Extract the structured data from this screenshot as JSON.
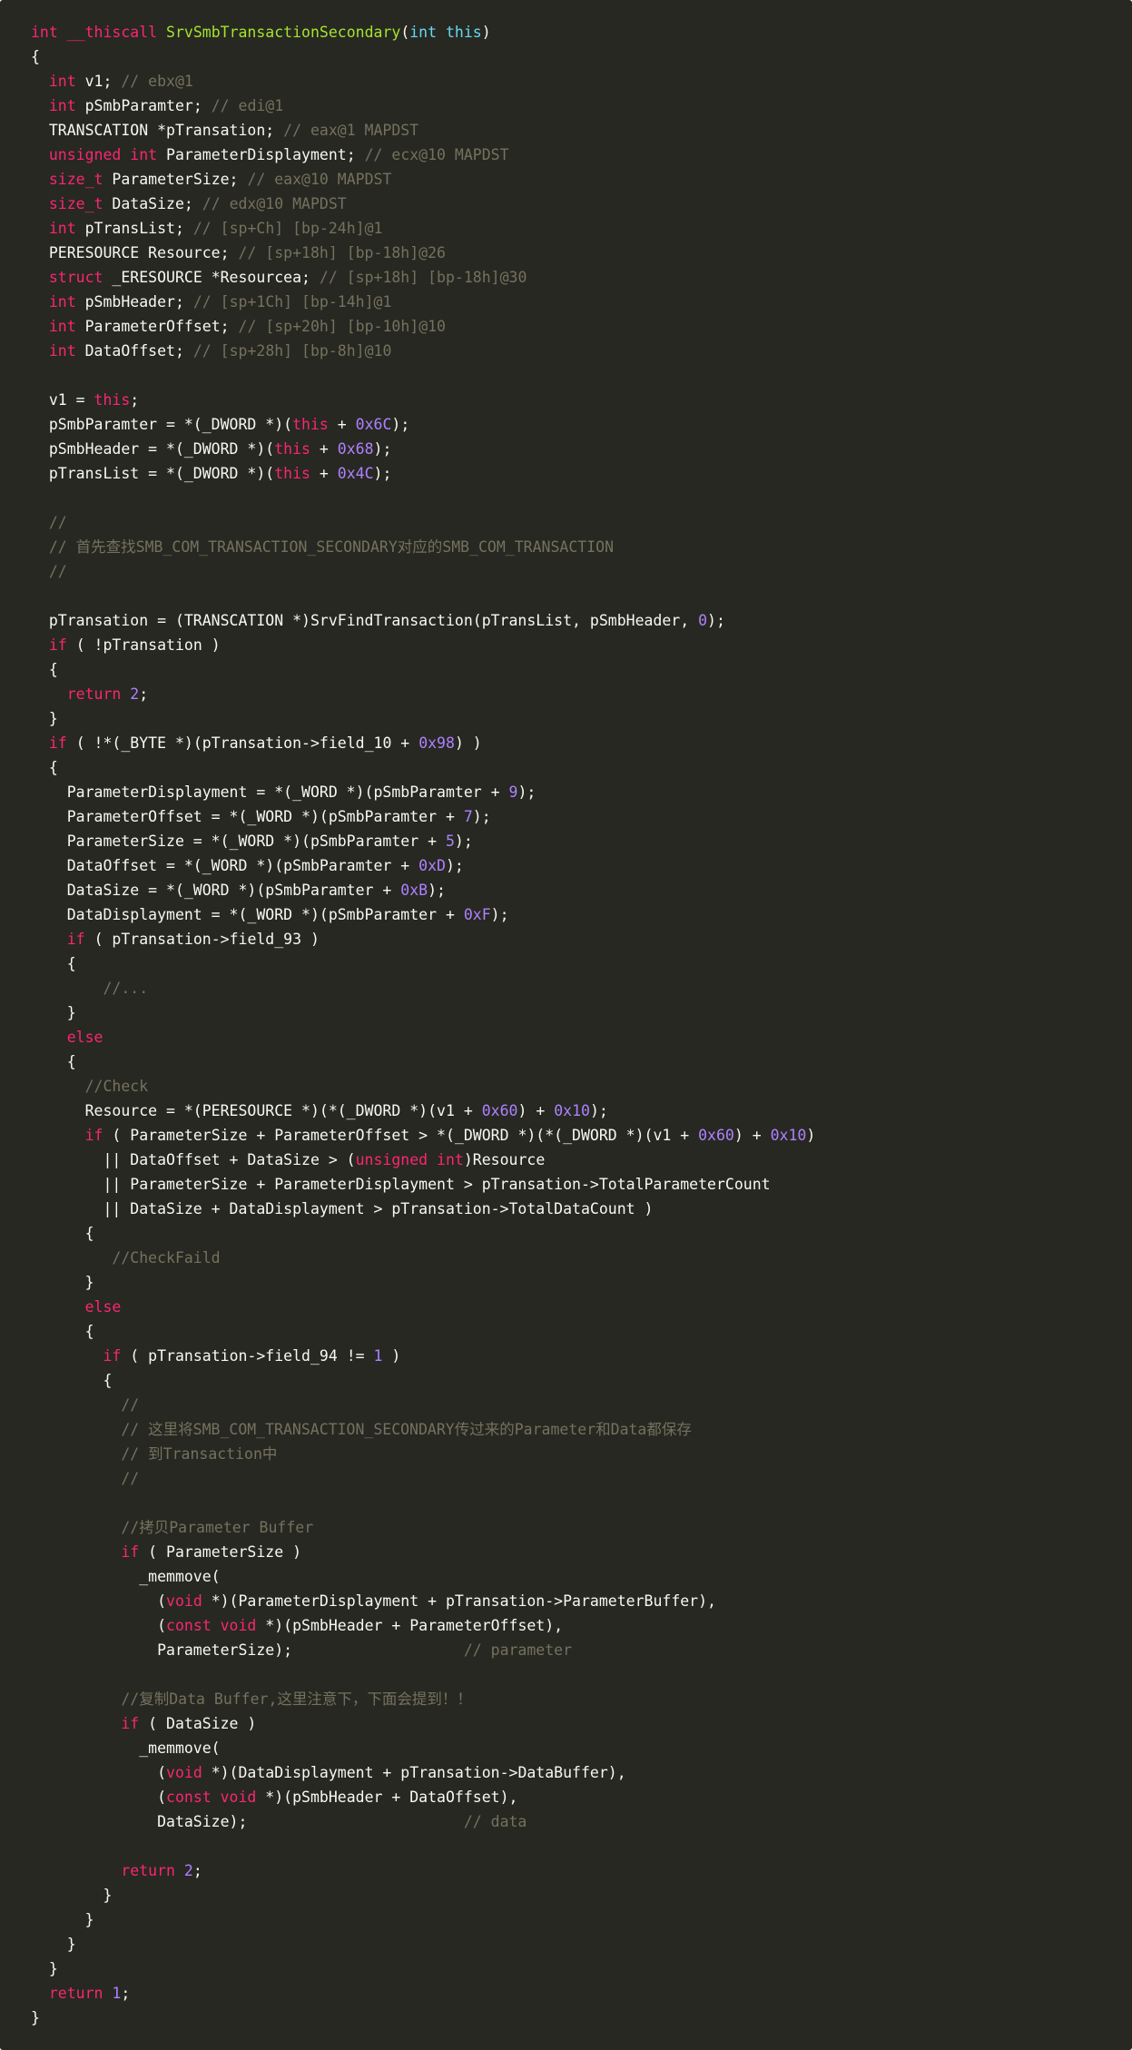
{
  "colors": {
    "background": "#272822",
    "plain": "#f8f8f2",
    "keyword": "#f92672",
    "type": "#66d9ef",
    "function": "#a6e22e",
    "number": "#ae81ff",
    "comment": "#75715e"
  },
  "code": {
    "lines": [
      [
        [
          "kw",
          "int "
        ],
        [
          "kw",
          "__thiscall "
        ],
        [
          "fn",
          "SrvSmbTransactionSecondary"
        ],
        [
          "pl",
          "("
        ],
        [
          "ty",
          "int "
        ],
        [
          "ty",
          "this"
        ],
        [
          "pl",
          ")"
        ]
      ],
      [
        [
          "pl",
          "{"
        ]
      ],
      [
        [
          "pl",
          "  "
        ],
        [
          "kw",
          "int "
        ],
        [
          "pl",
          "v1; "
        ],
        [
          "cm",
          "// ebx@1"
        ]
      ],
      [
        [
          "pl",
          "  "
        ],
        [
          "kw",
          "int "
        ],
        [
          "pl",
          "pSmbParamter; "
        ],
        [
          "cm",
          "// edi@1"
        ]
      ],
      [
        [
          "pl",
          "  TRANSCATION *pTransation; "
        ],
        [
          "cm",
          "// eax@1 MAPDST"
        ]
      ],
      [
        [
          "pl",
          "  "
        ],
        [
          "kw",
          "unsigned "
        ],
        [
          "kw",
          "int "
        ],
        [
          "pl",
          "ParameterDisplayment; "
        ],
        [
          "cm",
          "// ecx@10 MAPDST"
        ]
      ],
      [
        [
          "pl",
          "  "
        ],
        [
          "kw",
          "size_t "
        ],
        [
          "pl",
          "ParameterSize; "
        ],
        [
          "cm",
          "// eax@10 MAPDST"
        ]
      ],
      [
        [
          "pl",
          "  "
        ],
        [
          "kw",
          "size_t "
        ],
        [
          "pl",
          "DataSize; "
        ],
        [
          "cm",
          "// edx@10 MAPDST"
        ]
      ],
      [
        [
          "pl",
          "  "
        ],
        [
          "kw",
          "int "
        ],
        [
          "pl",
          "pTransList; "
        ],
        [
          "cm",
          "// [sp+Ch] [bp-24h]@1"
        ]
      ],
      [
        [
          "pl",
          "  PERESOURCE Resource; "
        ],
        [
          "cm",
          "// [sp+18h] [bp-18h]@26"
        ]
      ],
      [
        [
          "pl",
          "  "
        ],
        [
          "kw",
          "struct "
        ],
        [
          "pl",
          "_ERESOURCE *Resourcea; "
        ],
        [
          "cm",
          "// [sp+18h] [bp-18h]@30"
        ]
      ],
      [
        [
          "pl",
          "  "
        ],
        [
          "kw",
          "int "
        ],
        [
          "pl",
          "pSmbHeader; "
        ],
        [
          "cm",
          "// [sp+1Ch] [bp-14h]@1"
        ]
      ],
      [
        [
          "pl",
          "  "
        ],
        [
          "kw",
          "int "
        ],
        [
          "pl",
          "ParameterOffset; "
        ],
        [
          "cm",
          "// [sp+20h] [bp-10h]@10"
        ]
      ],
      [
        [
          "pl",
          "  "
        ],
        [
          "kw",
          "int "
        ],
        [
          "pl",
          "DataOffset; "
        ],
        [
          "cm",
          "// [sp+28h] [bp-8h]@10"
        ]
      ],
      [],
      [
        [
          "pl",
          "  v1 = "
        ],
        [
          "kw",
          "this"
        ],
        [
          "pl",
          ";"
        ]
      ],
      [
        [
          "pl",
          "  pSmbParamter = *(_DWORD *)("
        ],
        [
          "kw",
          "this"
        ],
        [
          "pl",
          " + "
        ],
        [
          "nm",
          "0x6C"
        ],
        [
          "pl",
          ");"
        ]
      ],
      [
        [
          "pl",
          "  pSmbHeader = *(_DWORD *)("
        ],
        [
          "kw",
          "this"
        ],
        [
          "pl",
          " + "
        ],
        [
          "nm",
          "0x68"
        ],
        [
          "pl",
          ");"
        ]
      ],
      [
        [
          "pl",
          "  pTransList = *(_DWORD *)("
        ],
        [
          "kw",
          "this"
        ],
        [
          "pl",
          " + "
        ],
        [
          "nm",
          "0x4C"
        ],
        [
          "pl",
          ");"
        ]
      ],
      [],
      [
        [
          "pl",
          "  "
        ],
        [
          "cm",
          "//"
        ]
      ],
      [
        [
          "pl",
          "  "
        ],
        [
          "cm",
          "// 首先查找SMB_COM_TRANSACTION_SECONDARY对应的SMB_COM_TRANSACTION"
        ]
      ],
      [
        [
          "pl",
          "  "
        ],
        [
          "cm",
          "//"
        ]
      ],
      [],
      [
        [
          "pl",
          "  pTransation = (TRANSCATION *)SrvFindTransaction(pTransList, pSmbHeader, "
        ],
        [
          "nm",
          "0"
        ],
        [
          "pl",
          ");"
        ]
      ],
      [
        [
          "pl",
          "  "
        ],
        [
          "kw",
          "if "
        ],
        [
          "pl",
          "( !pTransation )"
        ]
      ],
      [
        [
          "pl",
          "  {"
        ]
      ],
      [
        [
          "pl",
          "    "
        ],
        [
          "kw",
          "return "
        ],
        [
          "nm",
          "2"
        ],
        [
          "pl",
          ";"
        ]
      ],
      [
        [
          "pl",
          "  }"
        ]
      ],
      [
        [
          "pl",
          "  "
        ],
        [
          "kw",
          "if "
        ],
        [
          "pl",
          "( !*(_BYTE *)(pTransation->field_10 + "
        ],
        [
          "nm",
          "0x98"
        ],
        [
          "pl",
          ") )"
        ]
      ],
      [
        [
          "pl",
          "  {"
        ]
      ],
      [
        [
          "pl",
          "    ParameterDisplayment = *(_WORD *)(pSmbParamter + "
        ],
        [
          "nm",
          "9"
        ],
        [
          "pl",
          ");"
        ]
      ],
      [
        [
          "pl",
          "    ParameterOffset = *(_WORD *)(pSmbParamter + "
        ],
        [
          "nm",
          "7"
        ],
        [
          "pl",
          ");"
        ]
      ],
      [
        [
          "pl",
          "    ParameterSize = *(_WORD *)(pSmbParamter + "
        ],
        [
          "nm",
          "5"
        ],
        [
          "pl",
          ");"
        ]
      ],
      [
        [
          "pl",
          "    DataOffset = *(_WORD *)(pSmbParamter + "
        ],
        [
          "nm",
          "0xD"
        ],
        [
          "pl",
          ");"
        ]
      ],
      [
        [
          "pl",
          "    DataSize = *(_WORD *)(pSmbParamter + "
        ],
        [
          "nm",
          "0xB"
        ],
        [
          "pl",
          ");"
        ]
      ],
      [
        [
          "pl",
          "    DataDisplayment = *(_WORD *)(pSmbParamter + "
        ],
        [
          "nm",
          "0xF"
        ],
        [
          "pl",
          ");"
        ]
      ],
      [
        [
          "pl",
          "    "
        ],
        [
          "kw",
          "if "
        ],
        [
          "pl",
          "( pTransation->field_93 )"
        ]
      ],
      [
        [
          "pl",
          "    {"
        ]
      ],
      [
        [
          "pl",
          "        "
        ],
        [
          "cm",
          "//..."
        ]
      ],
      [
        [
          "pl",
          "    }"
        ]
      ],
      [
        [
          "pl",
          "    "
        ],
        [
          "kw",
          "else"
        ]
      ],
      [
        [
          "pl",
          "    {"
        ]
      ],
      [
        [
          "pl",
          "      "
        ],
        [
          "cm",
          "//Check"
        ]
      ],
      [
        [
          "pl",
          "      Resource = *(PERESOURCE *)(*(_DWORD *)(v1 + "
        ],
        [
          "nm",
          "0x60"
        ],
        [
          "pl",
          ") + "
        ],
        [
          "nm",
          "0x10"
        ],
        [
          "pl",
          ");"
        ]
      ],
      [
        [
          "pl",
          "      "
        ],
        [
          "kw",
          "if "
        ],
        [
          "pl",
          "( ParameterSize + ParameterOffset > *(_DWORD *)(*(_DWORD *)(v1 + "
        ],
        [
          "nm",
          "0x60"
        ],
        [
          "pl",
          ") + "
        ],
        [
          "nm",
          "0x10"
        ],
        [
          "pl",
          ")"
        ]
      ],
      [
        [
          "pl",
          "        || DataOffset + DataSize > ("
        ],
        [
          "kw",
          "unsigned "
        ],
        [
          "kw",
          "int"
        ],
        [
          "pl",
          ")Resource"
        ]
      ],
      [
        [
          "pl",
          "        || ParameterSize + ParameterDisplayment > pTransation->TotalParameterCount"
        ]
      ],
      [
        [
          "pl",
          "        || DataSize + DataDisplayment > pTransation->TotalDataCount )"
        ]
      ],
      [
        [
          "pl",
          "      {"
        ]
      ],
      [
        [
          "pl",
          "         "
        ],
        [
          "cm",
          "//CheckFaild"
        ]
      ],
      [
        [
          "pl",
          "      }"
        ]
      ],
      [
        [
          "pl",
          "      "
        ],
        [
          "kw",
          "else"
        ]
      ],
      [
        [
          "pl",
          "      {"
        ]
      ],
      [
        [
          "pl",
          "        "
        ],
        [
          "kw",
          "if "
        ],
        [
          "pl",
          "( pTransation->field_94 != "
        ],
        [
          "nm",
          "1"
        ],
        [
          "pl",
          " )"
        ]
      ],
      [
        [
          "pl",
          "        {"
        ]
      ],
      [
        [
          "pl",
          "          "
        ],
        [
          "cm",
          "//"
        ]
      ],
      [
        [
          "pl",
          "          "
        ],
        [
          "cm",
          "// 这里将SMB_COM_TRANSACTION_SECONDARY传过来的Parameter和Data都保存"
        ]
      ],
      [
        [
          "pl",
          "          "
        ],
        [
          "cm",
          "// 到Transaction中"
        ]
      ],
      [
        [
          "pl",
          "          "
        ],
        [
          "cm",
          "//"
        ]
      ],
      [],
      [
        [
          "pl",
          "          "
        ],
        [
          "cm",
          "//拷贝Parameter Buffer"
        ]
      ],
      [
        [
          "pl",
          "          "
        ],
        [
          "kw",
          "if "
        ],
        [
          "pl",
          "( ParameterSize )"
        ]
      ],
      [
        [
          "pl",
          "            _memmove("
        ]
      ],
      [
        [
          "pl",
          "              ("
        ],
        [
          "kw",
          "void "
        ],
        [
          "pl",
          "*)(ParameterDisplayment + pTransation->ParameterBuffer),"
        ]
      ],
      [
        [
          "pl",
          "              ("
        ],
        [
          "kw",
          "const "
        ],
        [
          "kw",
          "void "
        ],
        [
          "pl",
          "*)(pSmbHeader + ParameterOffset),"
        ]
      ],
      [
        [
          "pl",
          "              ParameterSize);                   "
        ],
        [
          "cm",
          "// parameter"
        ]
      ],
      [],
      [
        [
          "pl",
          "          "
        ],
        [
          "cm",
          "//复制Data Buffer,这里注意下，下面会提到！！"
        ]
      ],
      [
        [
          "pl",
          "          "
        ],
        [
          "kw",
          "if "
        ],
        [
          "pl",
          "( DataSize )"
        ]
      ],
      [
        [
          "pl",
          "            _memmove("
        ]
      ],
      [
        [
          "pl",
          "              ("
        ],
        [
          "kw",
          "void "
        ],
        [
          "pl",
          "*)(DataDisplayment + pTransation->DataBuffer),"
        ]
      ],
      [
        [
          "pl",
          "              ("
        ],
        [
          "kw",
          "const "
        ],
        [
          "kw",
          "void "
        ],
        [
          "pl",
          "*)(pSmbHeader + DataOffset),"
        ]
      ],
      [
        [
          "pl",
          "              DataSize);                        "
        ],
        [
          "cm",
          "// data"
        ]
      ],
      [],
      [
        [
          "pl",
          "          "
        ],
        [
          "kw",
          "return "
        ],
        [
          "nm",
          "2"
        ],
        [
          "pl",
          ";"
        ]
      ],
      [
        [
          "pl",
          "        }"
        ]
      ],
      [
        [
          "pl",
          "      }"
        ]
      ],
      [
        [
          "pl",
          "    }"
        ]
      ],
      [
        [
          "pl",
          "  }"
        ]
      ],
      [
        [
          "pl",
          "  "
        ],
        [
          "kw",
          "return "
        ],
        [
          "nm",
          "1"
        ],
        [
          "pl",
          ";"
        ]
      ],
      [
        [
          "pl",
          "}"
        ]
      ]
    ]
  }
}
